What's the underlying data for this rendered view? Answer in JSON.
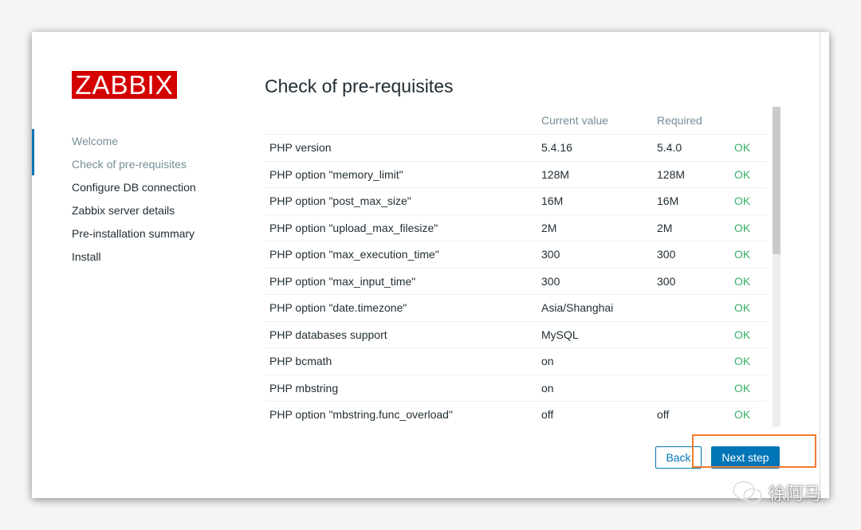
{
  "logo": {
    "text": "ZABBIX"
  },
  "nav": {
    "items": [
      {
        "label": "Welcome",
        "state": "done"
      },
      {
        "label": "Check of pre-requisites",
        "state": "current"
      },
      {
        "label": "Configure DB connection",
        "state": "pending"
      },
      {
        "label": "Zabbix server details",
        "state": "pending"
      },
      {
        "label": "Pre-installation summary",
        "state": "pending"
      },
      {
        "label": "Install",
        "state": "pending"
      }
    ]
  },
  "page": {
    "title": "Check of pre-requisites"
  },
  "table": {
    "headers": {
      "name": "",
      "current": "Current value",
      "required": "Required",
      "status": ""
    },
    "rows": [
      {
        "name": "PHP version",
        "current": "5.4.16",
        "required": "5.4.0",
        "status": "OK"
      },
      {
        "name": "PHP option \"memory_limit\"",
        "current": "128M",
        "required": "128M",
        "status": "OK"
      },
      {
        "name": "PHP option \"post_max_size\"",
        "current": "16M",
        "required": "16M",
        "status": "OK"
      },
      {
        "name": "PHP option \"upload_max_filesize\"",
        "current": "2M",
        "required": "2M",
        "status": "OK"
      },
      {
        "name": "PHP option \"max_execution_time\"",
        "current": "300",
        "required": "300",
        "status": "OK"
      },
      {
        "name": "PHP option \"max_input_time\"",
        "current": "300",
        "required": "300",
        "status": "OK"
      },
      {
        "name": "PHP option \"date.timezone\"",
        "current": "Asia/Shanghai",
        "required": "",
        "status": "OK"
      },
      {
        "name": "PHP databases support",
        "current": "MySQL",
        "required": "",
        "status": "OK"
      },
      {
        "name": "PHP bcmath",
        "current": "on",
        "required": "",
        "status": "OK"
      },
      {
        "name": "PHP mbstring",
        "current": "on",
        "required": "",
        "status": "OK"
      },
      {
        "name": "PHP option \"mbstring.func_overload\"",
        "current": "off",
        "required": "off",
        "status": "OK"
      }
    ]
  },
  "buttons": {
    "back": "Back",
    "next": "Next step"
  },
  "watermark": {
    "text": "徐阿马"
  },
  "colors": {
    "brand": "#d40000",
    "accent": "#0275b8",
    "ok": "#34af67",
    "muted": "#768d99",
    "highlight": "#f07c2e"
  }
}
